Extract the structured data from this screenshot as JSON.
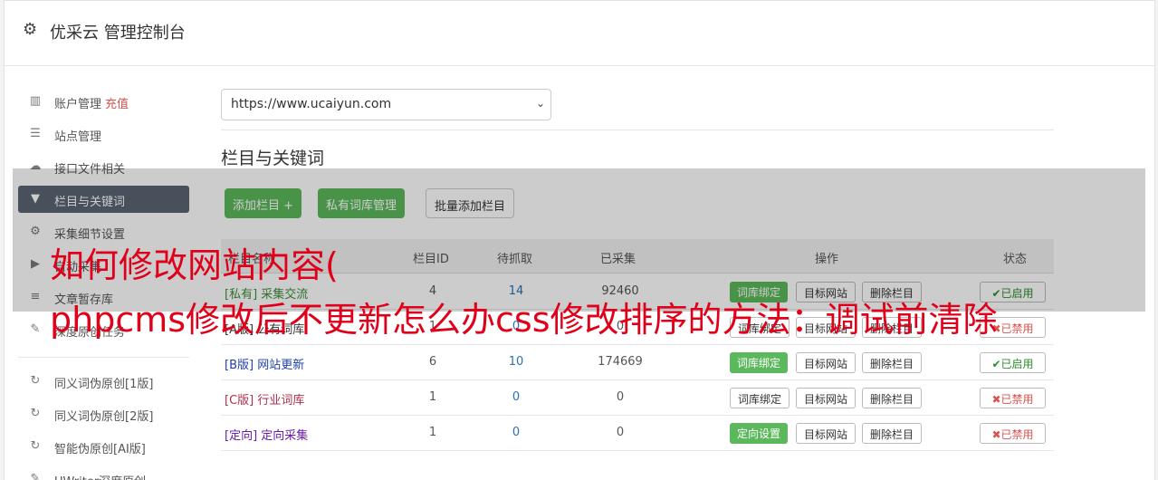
{
  "header": {
    "title": "优采云 管理控制台",
    "icon": "gear-icon"
  },
  "sidebar": {
    "items": [
      {
        "label": "账户管理",
        "icon": "bar-chart-icon",
        "extra": "充值"
      },
      {
        "label": "站点管理",
        "icon": "server-icon"
      },
      {
        "label": "接口文件相关",
        "icon": "cloud-upload-icon"
      },
      {
        "label": "栏目与关键词",
        "icon": "filter-icon",
        "active": true
      },
      {
        "label": "采集细节设置",
        "icon": "cogs-icon"
      },
      {
        "label": "自动采集",
        "icon": "play-circle-icon"
      },
      {
        "label": "文章暂存库",
        "icon": "database-icon"
      },
      {
        "label": "深度原创任务",
        "icon": "edit-icon"
      },
      {
        "label": "同义词伪原创[1版]",
        "icon": "refresh-icon"
      },
      {
        "label": "同义词伪原创[2版]",
        "icon": "refresh-icon"
      },
      {
        "label": "智能伪原创[AI版]",
        "icon": "refresh-icon"
      },
      {
        "label": "UWriter深度原创",
        "icon": "edit-icon"
      }
    ]
  },
  "site_select": {
    "value": "https://www.ucaiyun.com"
  },
  "section": {
    "title": "栏目与关键词"
  },
  "toolbar": {
    "add_column": "添加栏目 +",
    "private_lexicon": "私有词库管理",
    "batch_add": "批量添加栏目"
  },
  "table": {
    "headers": {
      "name": "栏目名称",
      "id": "栏目ID",
      "pending": "待抓取",
      "collected": "已采集",
      "actions": "操作",
      "status": "状态"
    },
    "rows": [
      {
        "tag": "[私有]",
        "name": "采集交流",
        "id": "4",
        "pending": "14",
        "collected": "92460",
        "bind": "词库绑定",
        "target": "目标网站",
        "delete": "删除栏目",
        "status": "已启用",
        "color": "#3c8d3c",
        "bind_green": true,
        "on": true
      },
      {
        "tag": "[A版]",
        "name": "公有词库",
        "id": "1",
        "pending": "0",
        "collected": "0",
        "bind": "词库绑定",
        "target": "目标网站",
        "delete": "删除栏目",
        "status": "已禁用",
        "color": "#333333",
        "bind_green": false,
        "on": false
      },
      {
        "tag": "[B版]",
        "name": "网站更新",
        "id": "6",
        "pending": "10",
        "collected": "174669",
        "bind": "词库绑定",
        "target": "目标网站",
        "delete": "删除栏目",
        "status": "已启用",
        "color": "#1f3fa8",
        "bind_green": true,
        "on": true
      },
      {
        "tag": "[C版]",
        "name": "行业词库",
        "id": "1",
        "pending": "0",
        "collected": "0",
        "bind": "词库绑定",
        "target": "目标网站",
        "delete": "删除栏目",
        "status": "已禁用",
        "color": "#b0304a",
        "bind_green": false,
        "on": false
      },
      {
        "tag": "[定向]",
        "name": "定向采集",
        "id": "1",
        "pending": "0",
        "collected": "0",
        "bind": "定向设置",
        "target": "目标网站",
        "delete": "删除栏目",
        "status": "已禁用",
        "color": "#6a1ab0",
        "bind_green": true,
        "on": false
      }
    ]
  },
  "overlay": {
    "line1": "如何修改网站内容(",
    "line2": "phpcms修改后不更新怎么办css修改排序的方法：调试前清除"
  }
}
